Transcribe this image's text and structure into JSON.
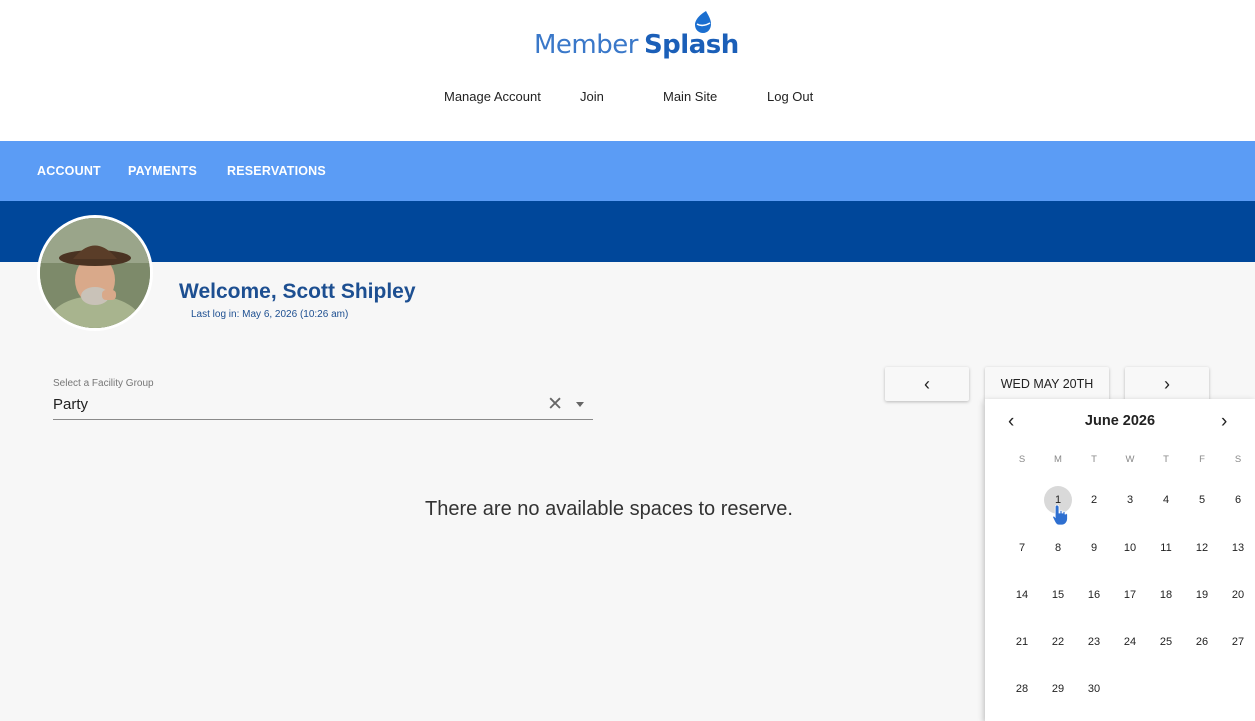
{
  "logo": {
    "part1": "Member",
    "part2": "Splash"
  },
  "top_links": [
    "Manage Account",
    "Join",
    "Main Site",
    "Log Out"
  ],
  "nav": [
    "ACCOUNT",
    "PAYMENTS",
    "RESERVATIONS"
  ],
  "user": {
    "welcome": "Welcome, Scott Shipley",
    "last_login": "Last log in: May 6, 2026 (10:26 am)"
  },
  "facility_select": {
    "label": "Select a Facility Group",
    "value": "Party"
  },
  "empty_message": "There are no available spaces to reserve.",
  "date_nav": {
    "current_date": "WED MAY 20TH"
  },
  "calendar": {
    "month_label": "June 2026",
    "weekdays": [
      "S",
      "M",
      "T",
      "W",
      "T",
      "F",
      "S"
    ],
    "weeks": [
      [
        "",
        "1",
        "2",
        "3",
        "4",
        "5",
        "6"
      ],
      [
        "7",
        "8",
        "9",
        "10",
        "11",
        "12",
        "13"
      ],
      [
        "14",
        "15",
        "16",
        "17",
        "18",
        "19",
        "20"
      ],
      [
        "21",
        "22",
        "23",
        "24",
        "25",
        "26",
        "27"
      ],
      [
        "28",
        "29",
        "30",
        "",
        "",
        "",
        ""
      ]
    ],
    "highlighted_day": "1"
  },
  "colors": {
    "nav_bar": "#5b9cf5",
    "header_band": "#00479a",
    "welcome_text": "#1d4f91",
    "logo_blue": "#3a78c9"
  }
}
